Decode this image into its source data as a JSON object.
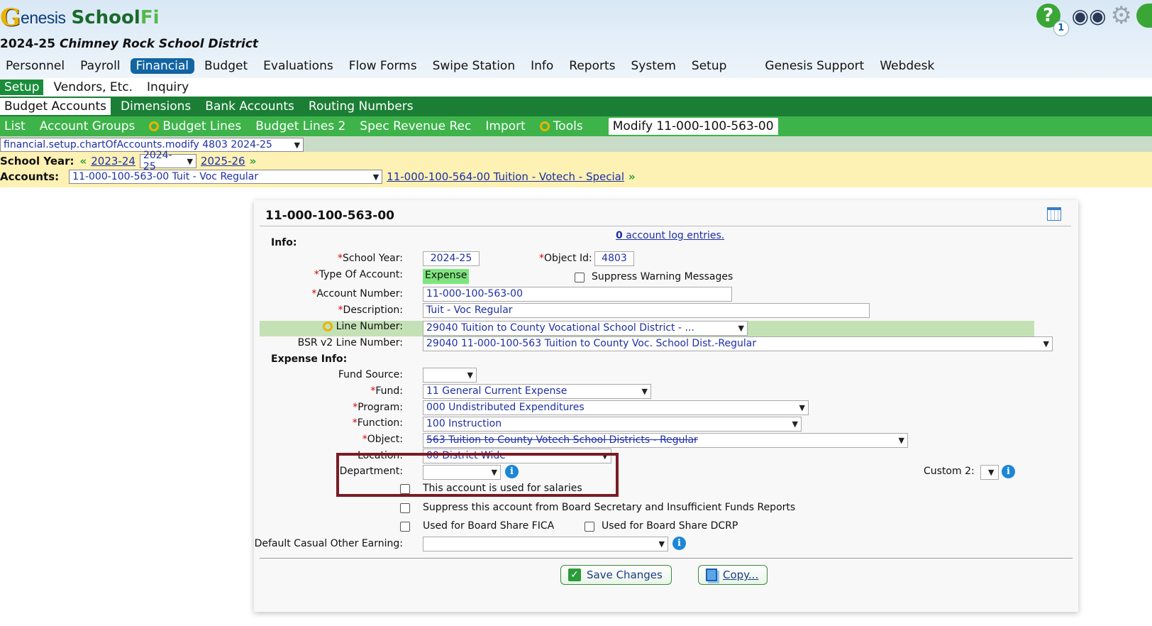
{
  "brand": {
    "g": "G",
    "genesis": "enesis",
    "school": "School",
    "fi": "Fi"
  },
  "district": {
    "year": "2024-25",
    "name": "Chimney Rock School District"
  },
  "top_icons": {
    "help_badge": "1",
    "help": "?"
  },
  "main_nav": [
    "Personnel",
    "Payroll",
    "Financial",
    "Budget",
    "Evaluations",
    "Flow Forms",
    "Swipe Station",
    "Info",
    "Reports",
    "System",
    "Setup",
    "Genesis Support",
    "Webdesk"
  ],
  "sub_nav1": [
    "Setup",
    "Vendors, Etc.",
    "Inquiry"
  ],
  "sub_nav2": [
    "Budget Accounts",
    "Dimensions",
    "Bank Accounts",
    "Routing Numbers"
  ],
  "sub_nav3": [
    "List",
    "Account Groups",
    "Budget Lines",
    "Budget Lines 2",
    "Spec Revenue Rec",
    "Import",
    "Tools",
    "Modify 11-000-100-563-00"
  ],
  "path_select": "financial.setup.chartOfAccounts.modify 4803 2024-25",
  "school_year_bar": {
    "label": "School Year:",
    "prev": "2023-24",
    "current": "2024-25",
    "next": "2025-26"
  },
  "accounts_bar": {
    "label": "Accounts:",
    "current": "11-000-100-563-00 Tuit - Voc Regular",
    "next": "11-000-100-564-00 Tuition - Votech - Special"
  },
  "panel": {
    "title": "11-000-100-563-00",
    "log_count": "0",
    "log_text": " account log entries.",
    "info_heading": "Info:",
    "school_year_label": "School Year:",
    "school_year_value": "2024-25",
    "object_id_label": "Object Id:",
    "object_id_value": "4803",
    "type_label": "Type Of Account:",
    "type_value": "Expense",
    "suppress_warning": "Suppress Warning Messages",
    "account_number_label": "Account Number:",
    "account_number_value": "11-000-100-563-00",
    "description_label": "Description:",
    "description_value": "Tuit -  Voc Regular",
    "line_number_label": "Line Number:",
    "line_number_value": "29040 Tuition to County Vocational School District - ...",
    "bsr_label": "BSR v2 Line Number:",
    "bsr_value": "29040 11-000-100-563 Tuition to County Voc. School Dist.-Regular",
    "expense_heading": "Expense Info:",
    "fund_source_label": "Fund Source:",
    "fund_source_value": "",
    "fund_label": "Fund:",
    "fund_value": "11 General Current Expense",
    "program_label": "Program:",
    "program_value": "000 Undistributed Expenditures",
    "function_label": "Function:",
    "function_value": "100 Instruction",
    "object_label": "Object:",
    "object_value": "563 Tuition to County Votech School Districts - Regular",
    "location_label": "Location:",
    "location_value": "00 District Wide",
    "department_label": "Department:",
    "department_value": "",
    "custom2_label": "Custom 2:",
    "salaries_text": "This account is used for salaries",
    "suppress_board_text": "Suppress this account from Board Secretary and Insufficient Funds Reports",
    "fica_text": "Used for Board Share FICA",
    "dcrp_text": "Used for Board Share DCRP",
    "casual_label": "Default Casual Other Earning:",
    "casual_value": "",
    "save_label": "Save Changes",
    "copy_label": "Copy..."
  },
  "colors": {
    "nav_blue": "#1264a3",
    "dark_green": "#1b7e35",
    "light_green": "#3db34a",
    "highlight": "#7a1c25"
  }
}
